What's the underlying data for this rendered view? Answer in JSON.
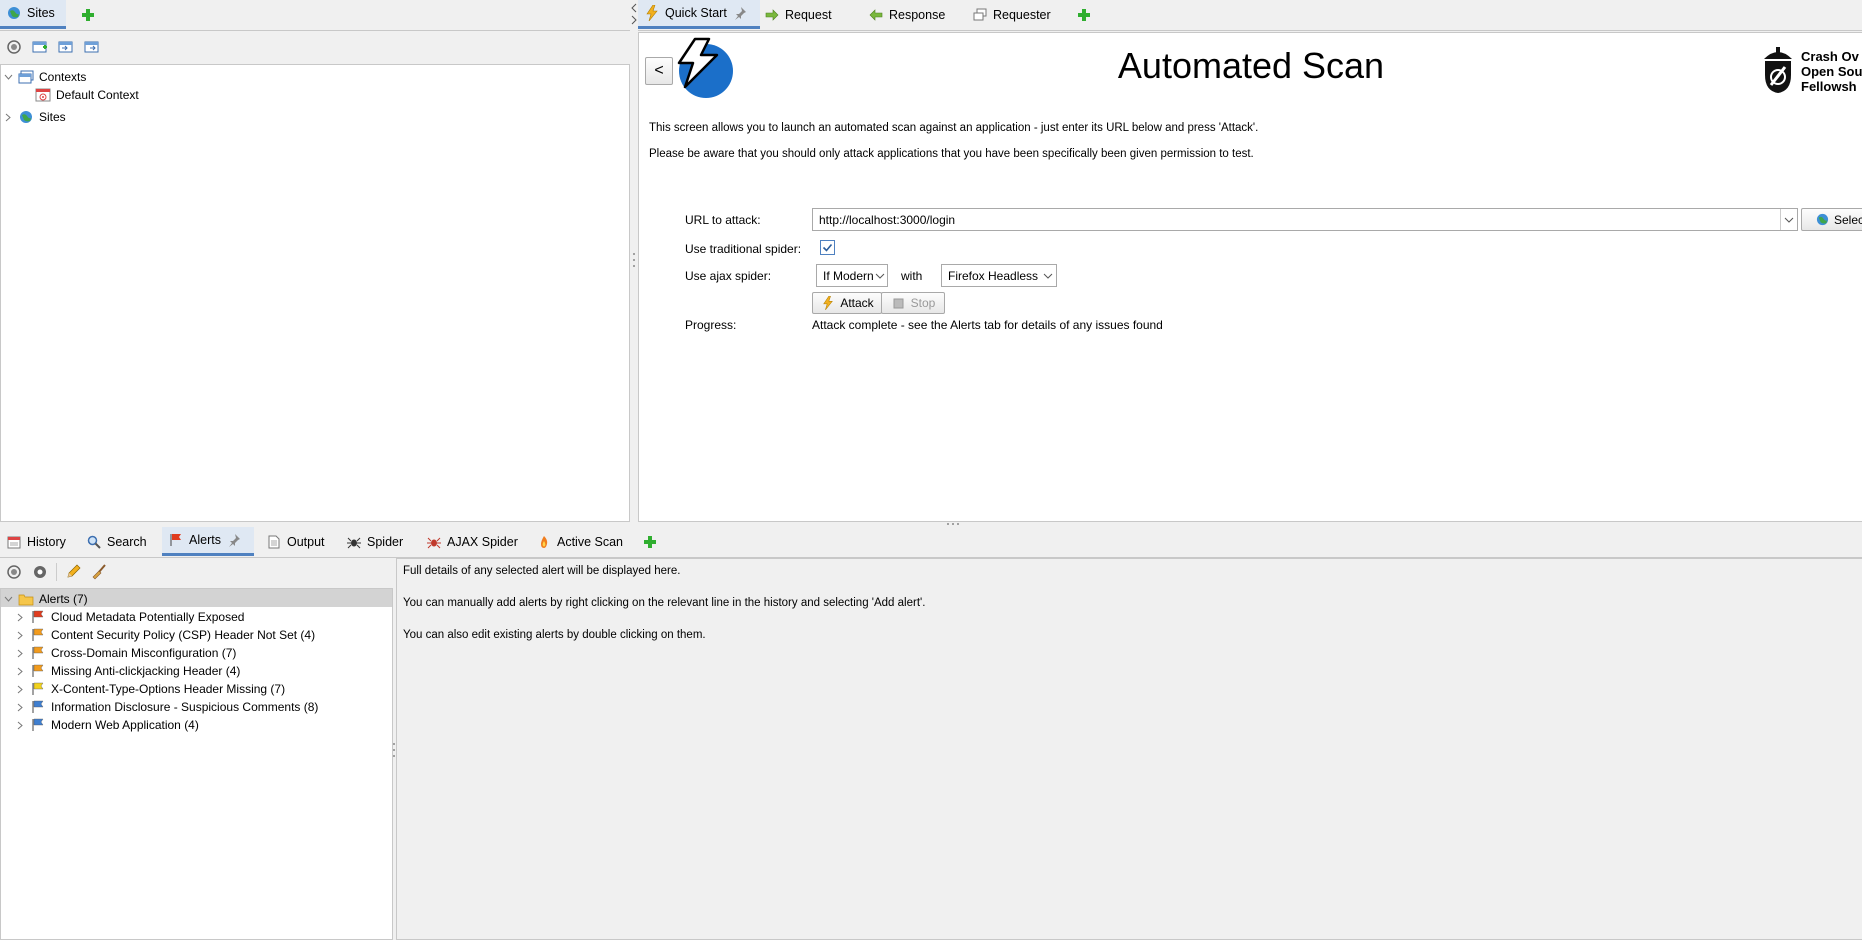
{
  "sites_panel": {
    "tab_label": "Sites",
    "tree": [
      {
        "label": "Contexts"
      },
      {
        "label": "Default Context"
      },
      {
        "label": "Sites"
      }
    ]
  },
  "workspace_tabs": [
    "Quick Start",
    "Request",
    "Response",
    "Requester"
  ],
  "quick_start": {
    "back_label": "<",
    "title": "Automated Scan",
    "brand_lines": [
      "Crash Ov",
      "Open Sou",
      "Fellowsh"
    ],
    "desc1": "This screen allows you to launch an automated scan against  an application - just enter its URL below and press 'Attack'.",
    "desc2": "Please be aware that you should only attack applications that you have been specifically been given permission to test.",
    "url_label": "URL to attack:",
    "url_value": "http://localhost:3000/login",
    "select_label": "Select...",
    "trad_spider_label": "Use traditional spider:",
    "trad_spider_checked": true,
    "ajax_spider_label": "Use ajax spider:",
    "ajax_mode": "If Modern",
    "with_label": "with",
    "browser": "Firefox Headless",
    "attack_label": "Attack",
    "stop_label": "Stop",
    "progress_label": "Progress:",
    "progress_value": "Attack complete - see the Alerts tab for details of any issues found"
  },
  "bottom_tabs": [
    "History",
    "Search",
    "Alerts",
    "Output",
    "Spider",
    "AJAX Spider",
    "Active Scan"
  ],
  "alerts": {
    "root_label": "Alerts (7)",
    "items": [
      {
        "label": "Cloud Metadata Potentially Exposed",
        "flag": "#e03c1f"
      },
      {
        "label": "Content Security Policy (CSP) Header Not Set (4)",
        "flag": "#f29b1d"
      },
      {
        "label": "Cross-Domain Misconfiguration (7)",
        "flag": "#f29b1d"
      },
      {
        "label": "Missing Anti-clickjacking Header (4)",
        "flag": "#f29b1d"
      },
      {
        "label": "X-Content-Type-Options Header Missing (7)",
        "flag": "#f2d21d"
      },
      {
        "label": "Information Disclosure - Suspicious Comments (8)",
        "flag": "#3f7fd0"
      },
      {
        "label": "Modern Web Application (4)",
        "flag": "#3f7fd0"
      }
    ],
    "detail_lines": [
      "Full details of any selected alert will be displayed here.",
      "You can manually add alerts by right clicking on the relevant line in the history and selecting 'Add alert'.",
      "You can also edit existing alerts by double clicking on them."
    ]
  },
  "colors": {
    "accent": "#4f81c0",
    "add_green": "#2fae2f",
    "zap_blue": "#1b6fc9"
  }
}
